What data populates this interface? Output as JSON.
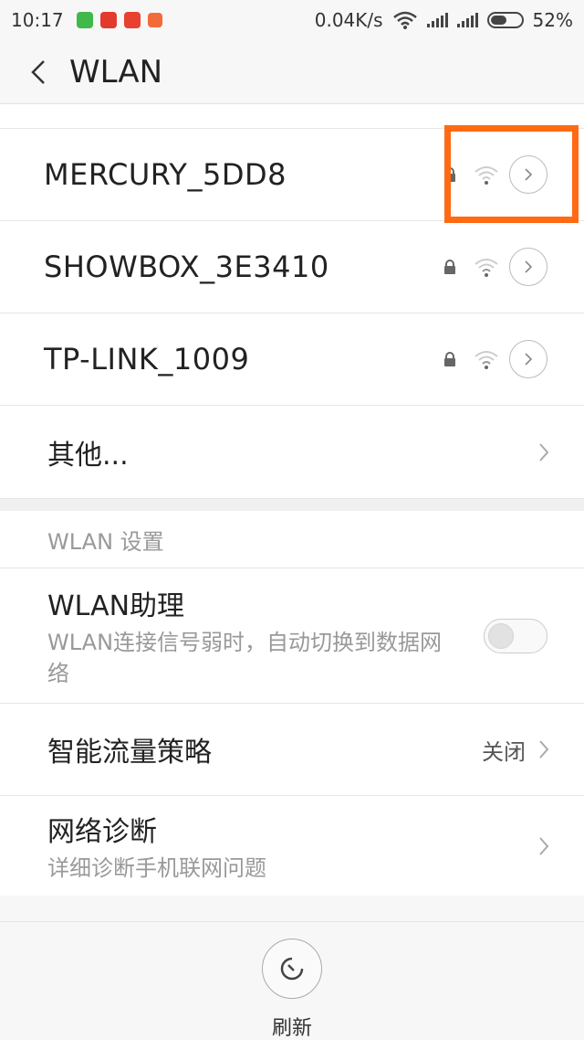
{
  "status_bar": {
    "time": "10:17",
    "net_speed": "0.04K/s",
    "battery": "52%",
    "battery_level": 0.52
  },
  "header": {
    "title": "WLAN"
  },
  "networks": [
    {
      "ssid": "MERCURY_5DD8",
      "secured": true
    },
    {
      "ssid": "SHOWBOX_3E3410",
      "secured": true
    },
    {
      "ssid": "TP-LINK_1009",
      "secured": true
    }
  ],
  "more_label": "其他...",
  "settings": {
    "header": "WLAN 设置",
    "assistant_title": "WLAN助理",
    "assistant_desc": "WLAN连接信号弱时，自动切换到数据网络",
    "assistant_enabled": false,
    "traffic_title": "智能流量策略",
    "traffic_value": "关闭",
    "diag_title": "网络诊断",
    "diag_desc": "详细诊断手机联网问题"
  },
  "bottom": {
    "refresh_label": "刷新"
  },
  "colors": {
    "highlight": "#ff6a13"
  }
}
